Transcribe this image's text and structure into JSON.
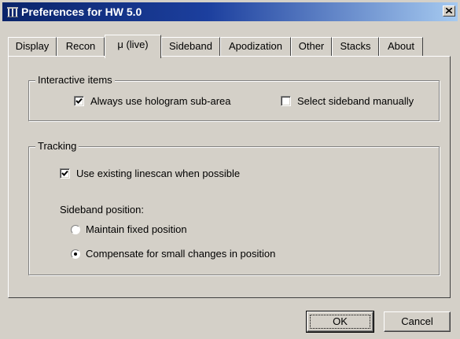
{
  "window": {
    "title": "Preferences for HW 5.0",
    "icons": {
      "app": "hologram-app-icon",
      "close": "close-icon"
    }
  },
  "tabs": [
    {
      "label": "Display",
      "active": false
    },
    {
      "label": "Recon",
      "active": false
    },
    {
      "label": "μ (live)",
      "active": true
    },
    {
      "label": "Sideband",
      "active": false
    },
    {
      "label": "Apodization",
      "active": false
    },
    {
      "label": "Other",
      "active": false
    },
    {
      "label": "Stacks",
      "active": false
    },
    {
      "label": "About",
      "active": false
    }
  ],
  "interactive_items": {
    "title": "Interactive items",
    "always_use_subarea": {
      "label": "Always use hologram sub-area",
      "checked": true
    },
    "select_sideband_manually": {
      "label": "Select sideband manually",
      "checked": false
    }
  },
  "tracking": {
    "title": "Tracking",
    "use_existing_linescan": {
      "label": "Use existing linescan when possible",
      "checked": true
    },
    "sideband_position_label": "Sideband position:",
    "options": [
      {
        "label": "Maintain fixed position",
        "selected": false
      },
      {
        "label": "Compensate for small changes in position",
        "selected": true
      }
    ]
  },
  "buttons": {
    "ok": "OK",
    "cancel": "Cancel"
  }
}
